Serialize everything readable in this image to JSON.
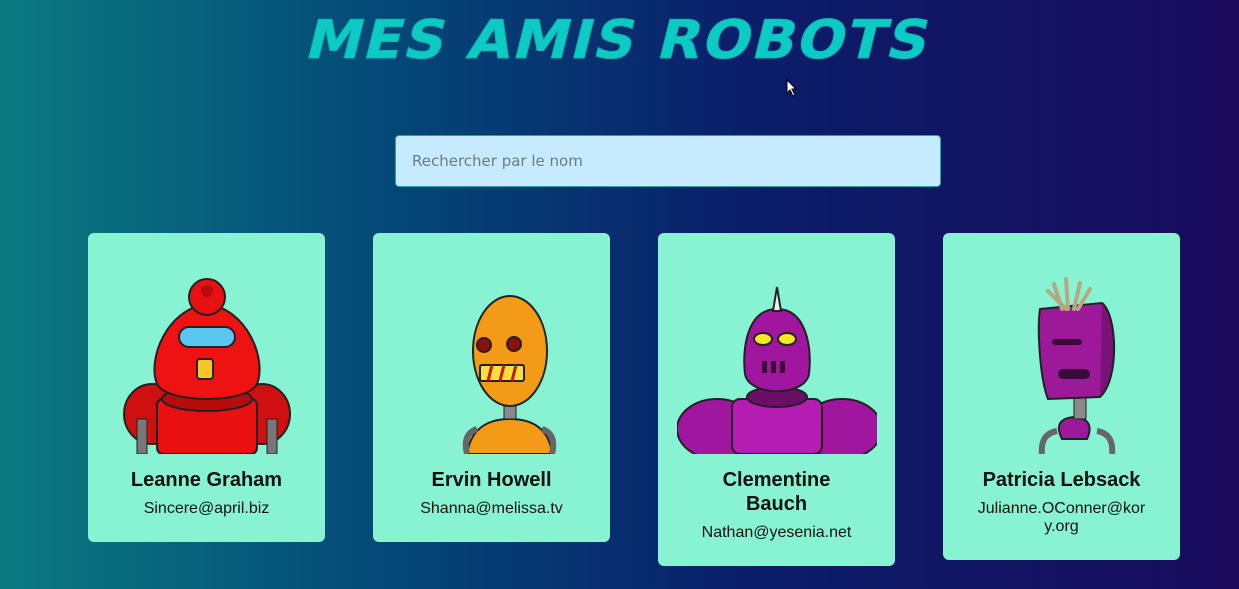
{
  "app": {
    "title": "MES AMIS ROBOTS"
  },
  "search": {
    "placeholder": "Rechercher par le nom",
    "value": ""
  },
  "robots": [
    {
      "name": "Leanne Graham",
      "email": "Sincere@april.biz",
      "color": "#e81010"
    },
    {
      "name": "Ervin Howell",
      "email": "Shanna@melissa.tv",
      "color": "#f39a17"
    },
    {
      "name": "Clementine Bauch",
      "email": "Nathan@yesenia.net",
      "color": "#a0169e"
    },
    {
      "name": "Patricia Lebsack",
      "email": "Julianne.OConner@kory.org",
      "color": "#9c1a9a"
    }
  ],
  "colors": {
    "accent": "#0ccac4",
    "card_background": "#88f3d3",
    "search_background": "#c7ebfe"
  }
}
